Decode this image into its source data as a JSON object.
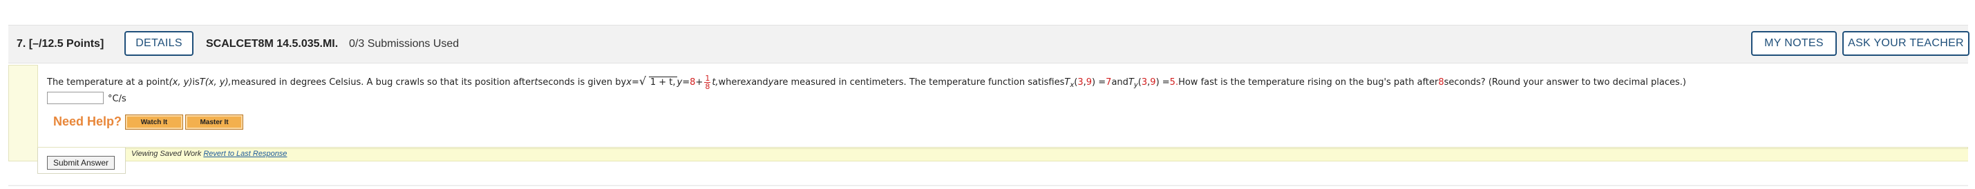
{
  "question": {
    "number_label": "7.",
    "points_label": "[–/12.5 Points]",
    "details_label": "DETAILS",
    "code": "SCALCET8M 14.5.035.MI.",
    "submissions": "0/3 Submissions Used",
    "my_notes_label": "MY NOTES",
    "ask_teacher_label": "ASK YOUR TEACHER"
  },
  "problem": {
    "p1": "The temperature at a point ",
    "p2": "(x, y)",
    "p3": " is ",
    "p4": "T(x, y),",
    "p5": " measured in degrees Celsius. A bug crawls so that its position after ",
    "p6": "t",
    "p7": " seconds is given by ",
    "p8": "x",
    "p9": " = ",
    "sqrt_inner": "1 + t,",
    "p10": " y",
    "p11": " = ",
    "red8": "8",
    "p12": " + ",
    "frac_n": "1",
    "frac_d": "8",
    "p13": "t,",
    "p14": " where ",
    "p15": "x",
    "p16": " and ",
    "p17": "y",
    "p18": " are measured in centimeters. The temperature function satisfies ",
    "tx": "T",
    "tx_sub": "x",
    "tx_open": "(",
    "tx_a": "3",
    "tx_comma": ", ",
    "tx_b": "9",
    "tx_close": ") = ",
    "tx_val": "7",
    "p19": " and ",
    "ty": "T",
    "ty_sub": "y",
    "ty_open": "(",
    "ty_a": "3",
    "ty_comma": ", ",
    "ty_b": "9",
    "ty_close": ") = ",
    "ty_val": "5.",
    "p20": " How fast is the temperature rising on the bug's path after ",
    "after_val": "8",
    "p21": " seconds? (Round your answer to two decimal places.)"
  },
  "answer": {
    "value": "",
    "unit": "°C/s"
  },
  "help": {
    "label": "Need Help?",
    "watch_label": "Watch It",
    "master_label": "Master It"
  },
  "footer": {
    "submit_label": "Submit Answer",
    "viewing_text": "Viewing Saved Work ",
    "revert_label": "Revert to Last Response"
  },
  "colors": {
    "accent_blue": "#1f4f7a",
    "red_values": "#d21f1f",
    "need_help_orange": "#e8873a",
    "help_button": "#f3b04e"
  }
}
